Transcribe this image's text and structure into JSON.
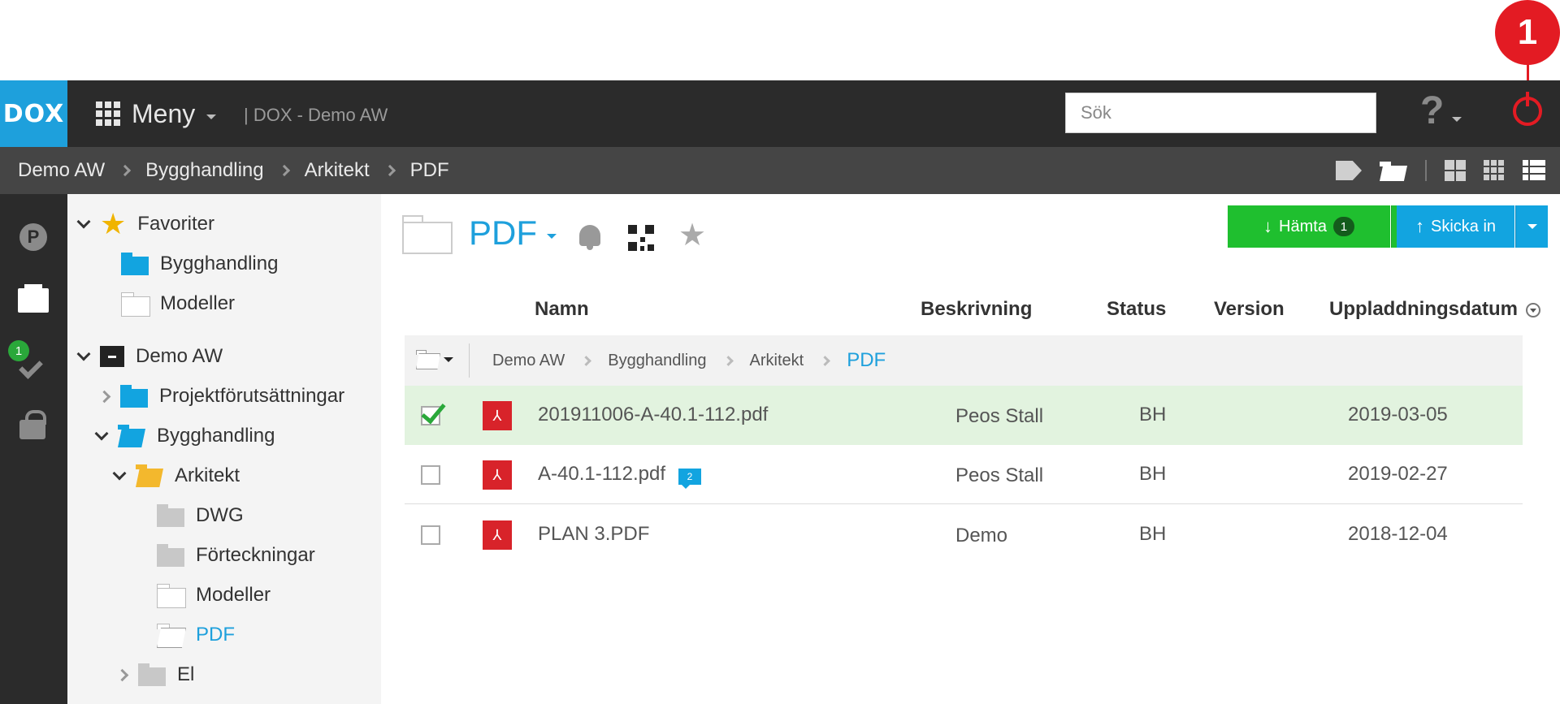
{
  "app": {
    "logo": "DOX",
    "menu_label": "Meny",
    "title": "| DOX - Demo AW"
  },
  "search": {
    "placeholder": "Sök"
  },
  "help": {
    "label": "?"
  },
  "annotation": {
    "marker": "1"
  },
  "breadcrumb": {
    "items": [
      "Demo AW",
      "Bygghandling",
      "Arkitekt",
      "PDF"
    ]
  },
  "rail": {
    "p_label": "P",
    "tasks_badge": "1"
  },
  "tree": {
    "favorites_label": "Favoriter",
    "favorites": [
      "Bygghandling",
      "Modeller"
    ],
    "project_label": "Demo AW",
    "items": {
      "projektforutsattningar": "Projektförutsättningar",
      "bygghandling": "Bygghandling",
      "arkitekt": "Arkitekt",
      "dwg": "DWG",
      "forteckningar": "Förteckningar",
      "modeller": "Modeller",
      "pdf": "PDF",
      "el": "El"
    }
  },
  "main": {
    "folder_title": "PDF",
    "download_button": {
      "label": "Hämta",
      "count": "1"
    },
    "upload_button": {
      "label": "Skicka in"
    },
    "columns": {
      "name": "Namn",
      "description": "Beskrivning",
      "status": "Status",
      "version": "Version",
      "upload_date": "Uppladdningsdatum"
    },
    "path": [
      "Demo AW",
      "Bygghandling",
      "Arkitekt",
      "PDF"
    ],
    "rows": [
      {
        "name": "201911006-A-40.1-112.pdf",
        "description": "Peos Stall",
        "status": "BH",
        "version": "",
        "date": "2019-03-05",
        "selected": true,
        "comments": ""
      },
      {
        "name": "A-40.1-112.pdf",
        "description": "Peos Stall",
        "status": "BH",
        "version": "",
        "date": "2019-02-27",
        "selected": false,
        "comments": "2"
      },
      {
        "name": "PLAN 3.PDF",
        "description": "Demo",
        "status": "BH",
        "version": "",
        "date": "2018-12-04",
        "selected": false,
        "comments": ""
      }
    ]
  },
  "colors": {
    "accent": "#1ea0dc",
    "download": "#1fbf2f",
    "upload": "#12a4e0",
    "danger": "#e31b23",
    "header": "#2b2b2b"
  }
}
